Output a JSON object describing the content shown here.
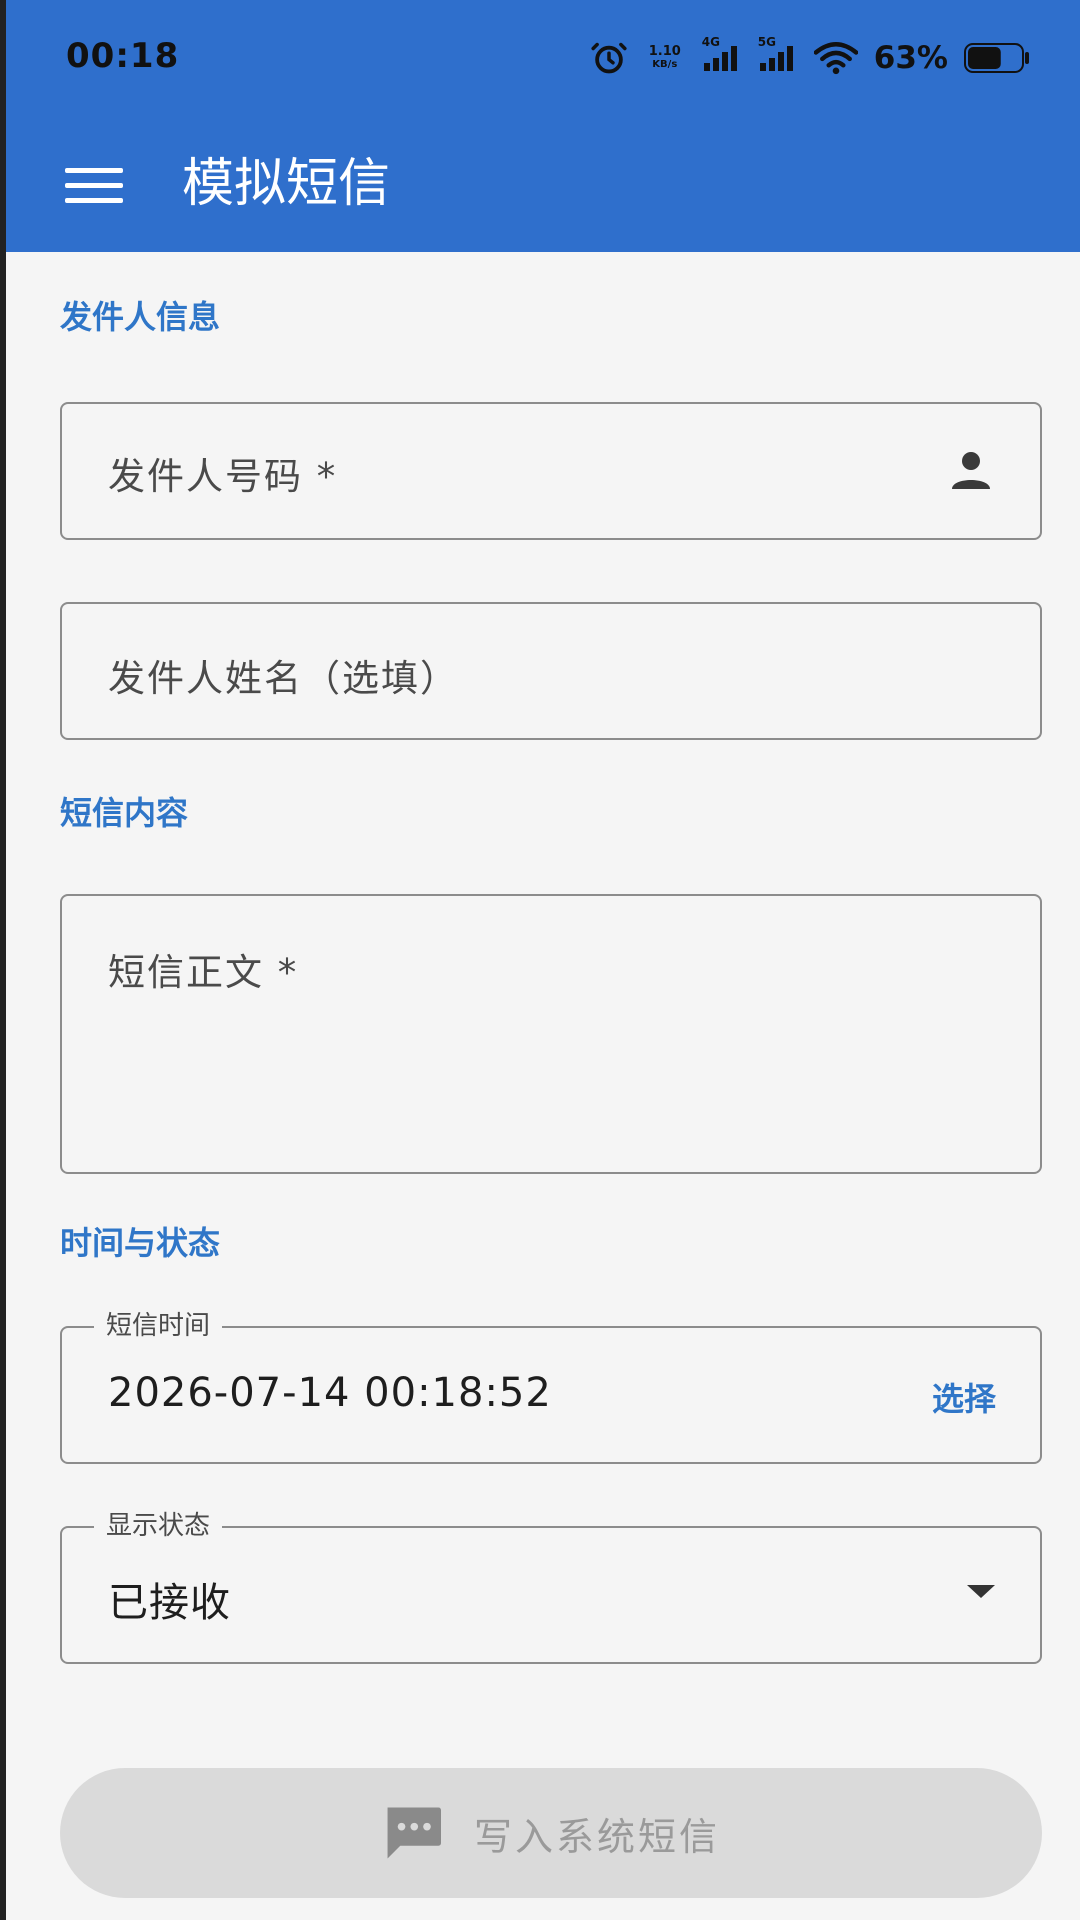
{
  "status_bar": {
    "time": "00:18",
    "net_speed_value": "1.10",
    "net_speed_unit": "KB/s",
    "sim1_tag": "4G",
    "sim2_tag": "5G",
    "battery_percent": "63%",
    "battery_level": 0.63
  },
  "app_bar": {
    "title": "模拟短信"
  },
  "sections": {
    "sender": "发件人信息",
    "content": "短信内容",
    "time_status": "时间与状态"
  },
  "fields": {
    "sender_number_placeholder": "发件人号码 *",
    "sender_name_placeholder": "发件人姓名（选填）",
    "message_body_placeholder": "短信正文 *",
    "sms_time_label": "短信时间",
    "sms_time_value": "2026-07-14 00:18:52",
    "sms_time_action": "选择",
    "display_status_label": "显示状态",
    "display_status_value": "已接收"
  },
  "actions": {
    "write_button_label": "写入系统短信"
  },
  "colors": {
    "app_bar": "#2f6fcc",
    "accent": "#2f76c8",
    "background": "#f5f5f5",
    "disabled_button": "#dadada"
  }
}
